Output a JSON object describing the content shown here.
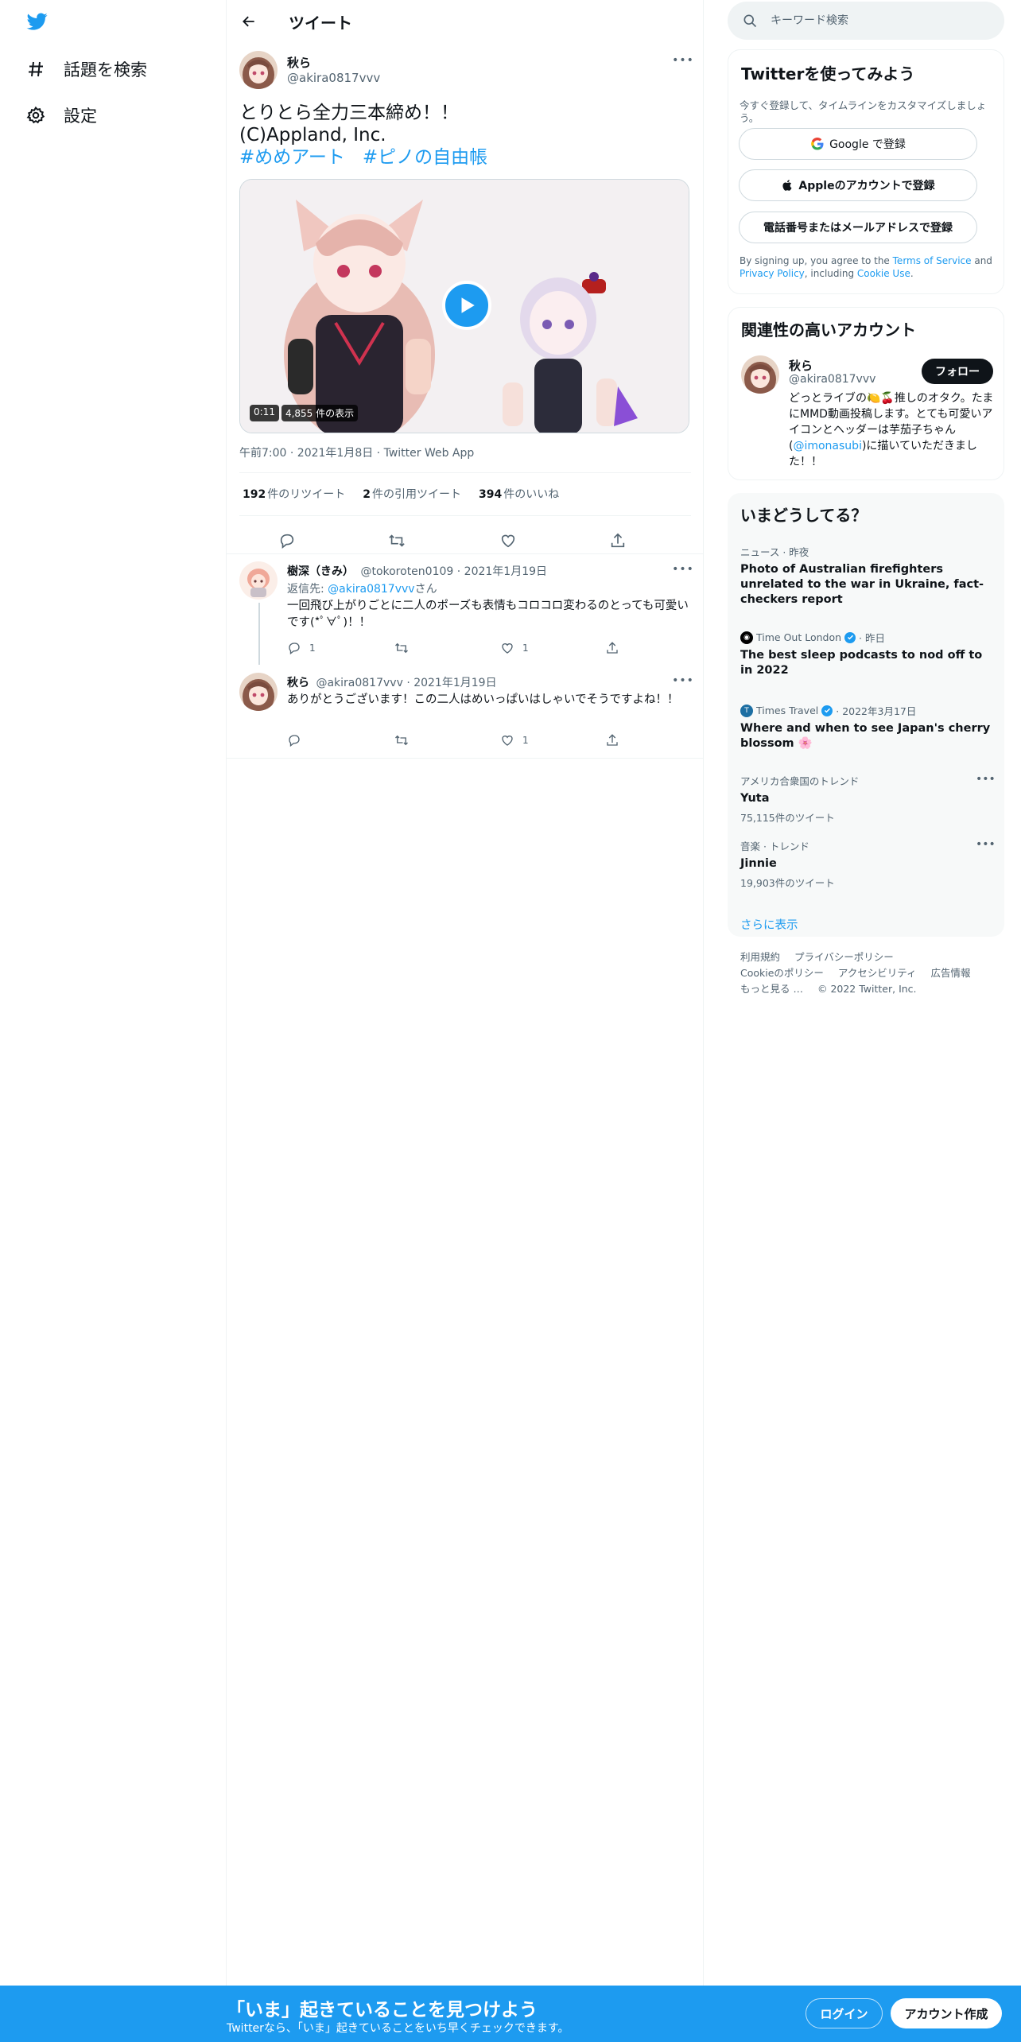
{
  "nav": {
    "logo_icon": "twitter-bird-icon",
    "items": [
      {
        "label": "話題を検索",
        "icon": "hashtag-icon"
      },
      {
        "label": "設定",
        "icon": "gear-icon"
      }
    ]
  },
  "header": {
    "title": "ツイート"
  },
  "tweet": {
    "author_name": "秋ら",
    "author_handle": "@akira0817vvv",
    "text_line1": "とりとら全力三本締め！！",
    "text_line2": "(C)Appland, Inc.",
    "hashtags": [
      "#めめアート",
      "#ピノの自由帳"
    ],
    "video": {
      "duration": "0:11",
      "views": "4,855 件の表示"
    },
    "meta": "午前7:00 · 2021年1月8日 · Twitter Web App",
    "stats": [
      {
        "count": "192",
        "label": "件のリツイート"
      },
      {
        "count": "2",
        "label": "件の引用ツイート"
      },
      {
        "count": "394",
        "label": "件のいいね"
      }
    ]
  },
  "replies": [
    {
      "name": "樹深（きみ）",
      "handle": "@tokoroten0109",
      "date": "· 2021年1月19日",
      "reply_to_prefix": "返信先: ",
      "reply_to_handle": "@akira0817vvv",
      "reply_to_suffix": "さん",
      "text": "一回飛び上がりごとに二人のポーズも表情もコロコロ変わるのとっても可愛いです(*ﾟ∀ﾟ)！！",
      "reply_count": "1",
      "like_count": "1"
    },
    {
      "name": "秋ら",
      "handle": "@akira0817vvv",
      "date": "· 2021年1月19日",
      "text": "ありがとうございます！この二人はめいっぱいはしゃいでそうですよね！！",
      "like_count": "1"
    }
  ],
  "search": {
    "placeholder": "キーワード検索"
  },
  "signup": {
    "title": "Twitterを使ってみよう",
    "subtitle": "今すぐ登録して、タイムラインをカスタマイズしましょう。",
    "google": "Google で登録",
    "apple": "Appleのアカウントで登録",
    "phone": "電話番号またはメールアドレスで登録",
    "terms_1": "By signing up, you agree to the ",
    "terms_link1": "Terms of Service",
    "terms_2": " and ",
    "terms_link2": "Privacy Policy",
    "terms_3": ", including ",
    "terms_link3": "Cookie Use",
    "terms_4": "."
  },
  "related": {
    "title": "関連性の高いアカウント",
    "name": "秋ら",
    "handle": "@akira0817vvv",
    "follow": "フォロー",
    "bio_1": "どっとライブの🍋🍒推しのオタク。たまにMMD動画投稿します。とても可愛いアイコンとヘッダーは芋茄子ちゃん(",
    "bio_link": "@imonasubi",
    "bio_2": ")に描いていただきました！！"
  },
  "trends": {
    "title": "いまどうしてる？",
    "items": [
      {
        "meta": "ニュース · 昨夜",
        "title": "Photo of Australian firefighters unrelated to the war in Ukraine, fact-checkers report"
      },
      {
        "source": "Time Out London",
        "meta": "· 昨日",
        "title": "The best sleep podcasts to nod off to in 2022"
      },
      {
        "source": "Times Travel",
        "meta": "· 2022年3月17日",
        "title": "Where and when to see Japan's cherry blossom 🌸"
      },
      {
        "meta": "アメリカ合衆国のトレンド",
        "title": "Yuta",
        "count": "75,115件のツイート"
      },
      {
        "meta": "音楽 · トレンド",
        "title": "Jinnie",
        "count": "19,903件のツイート"
      }
    ],
    "show_more": "さらに表示"
  },
  "footer": {
    "links": [
      "利用規約",
      "プライバシーポリシー",
      "Cookieのポリシー",
      "アクセシビリティ",
      "広告情報",
      "もっと見る …",
      "© 2022 Twitter, Inc."
    ]
  },
  "bottom_bar": {
    "title": "「いま」起きていることを見つけよう",
    "subtitle": "Twitterなら、「いま」起きていることをいち早くチェックできます。",
    "login": "ログイン",
    "signup": "アカウント作成"
  },
  "colors": {
    "accent": "#1d9bf0",
    "text": "#0f1419",
    "muted": "#536471"
  }
}
